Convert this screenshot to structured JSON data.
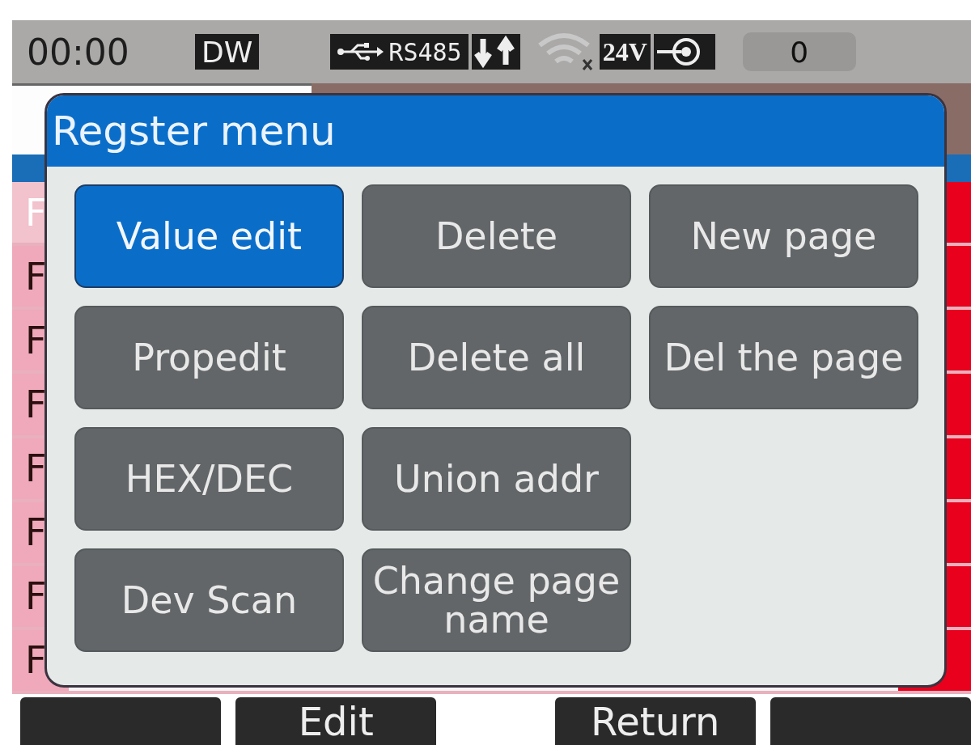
{
  "status_bar": {
    "time": "00:00",
    "mode": "DW",
    "port": "RS485",
    "wifi_connected": false,
    "supply": "24V",
    "counter": "0"
  },
  "table": {
    "rows": [
      {
        "cell": "F",
        "selected": true
      },
      {
        "cell": "F",
        "selected": false
      },
      {
        "cell": "F",
        "selected": false
      },
      {
        "cell": "F",
        "selected": false
      },
      {
        "cell": "F",
        "selected": false
      },
      {
        "cell": "F",
        "selected": false
      },
      {
        "cell": "F",
        "selected": false
      },
      {
        "cell": "F",
        "selected": false
      }
    ]
  },
  "dialog": {
    "title": "Regster menu",
    "items": [
      {
        "label": "Value edit",
        "selected": true
      },
      {
        "label": "Delete",
        "selected": false
      },
      {
        "label": "New page",
        "selected": false
      },
      {
        "label": "Propedit",
        "selected": false
      },
      {
        "label": "Delete all",
        "selected": false
      },
      {
        "label": "Del the page",
        "selected": false
      },
      {
        "label": "HEX/DEC",
        "selected": false
      },
      {
        "label": "Union addr",
        "selected": false
      },
      {
        "kind": "empty"
      },
      {
        "label": "Dev Scan",
        "selected": false
      },
      {
        "label": "Change page name",
        "selected": false
      }
    ]
  },
  "softkeys": [
    {
      "kind": "key"
    },
    {
      "kind": "key",
      "label": "Edit"
    },
    {
      "kind": "gap"
    },
    {
      "kind": "key",
      "label": "Return"
    },
    {
      "kind": "key"
    }
  ]
}
